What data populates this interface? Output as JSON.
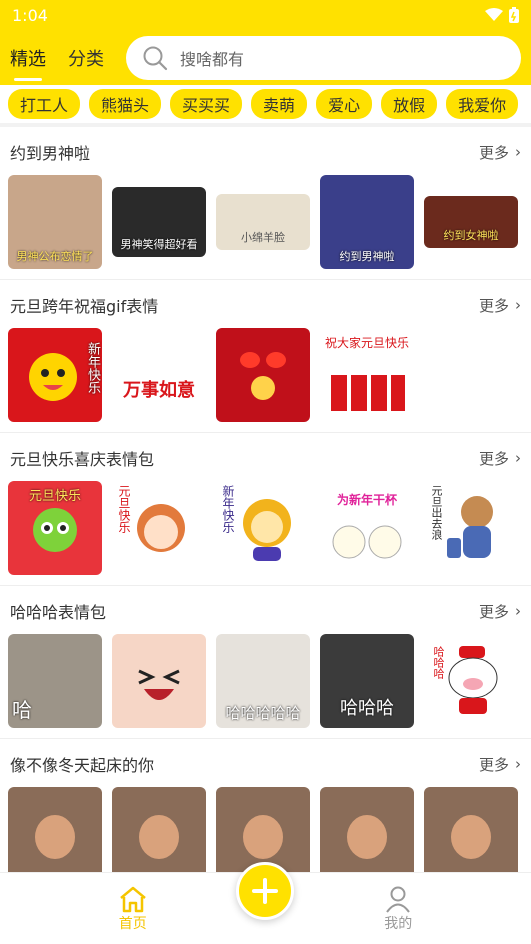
{
  "status": {
    "time": "1:04"
  },
  "top": {
    "tabs": [
      "精选",
      "分类"
    ],
    "search_placeholder": "搜啥都有"
  },
  "tags": [
    "打工人",
    "熊猫头",
    "买买买",
    "卖萌",
    "爱心",
    "放假",
    "我爱你"
  ],
  "sections": [
    {
      "title": "约到男神啦",
      "more": "更多",
      "captions": [
        "男神公布恋情了",
        "男神笑得超好看",
        "小绵羊脸",
        "约到男神啦",
        "约到女神啦"
      ]
    },
    {
      "title": "元旦跨年祝福gif表情",
      "more": "更多",
      "captions": [
        "新年快乐",
        "万事如意",
        "",
        "祝大家元旦快乐",
        ""
      ]
    },
    {
      "title": "元旦快乐喜庆表情包",
      "more": "更多",
      "captions": [
        "元旦快乐",
        "元旦快乐",
        "新年快乐",
        "为新年干杯",
        "元旦出去浪"
      ]
    },
    {
      "title": "哈哈哈表情包",
      "more": "更多",
      "captions": [
        "哈",
        "",
        "哈哈哈哈哈",
        "哈哈哈",
        "哈哈哈"
      ]
    },
    {
      "title": "像不像冬天起床的你",
      "more": "更多",
      "captions": [
        "",
        "",
        "",
        "",
        ""
      ]
    }
  ],
  "nav": {
    "home": "首页",
    "mine": "我的"
  },
  "colors": {
    "accent": "#ffe100",
    "nav_active": "#f5c500"
  }
}
